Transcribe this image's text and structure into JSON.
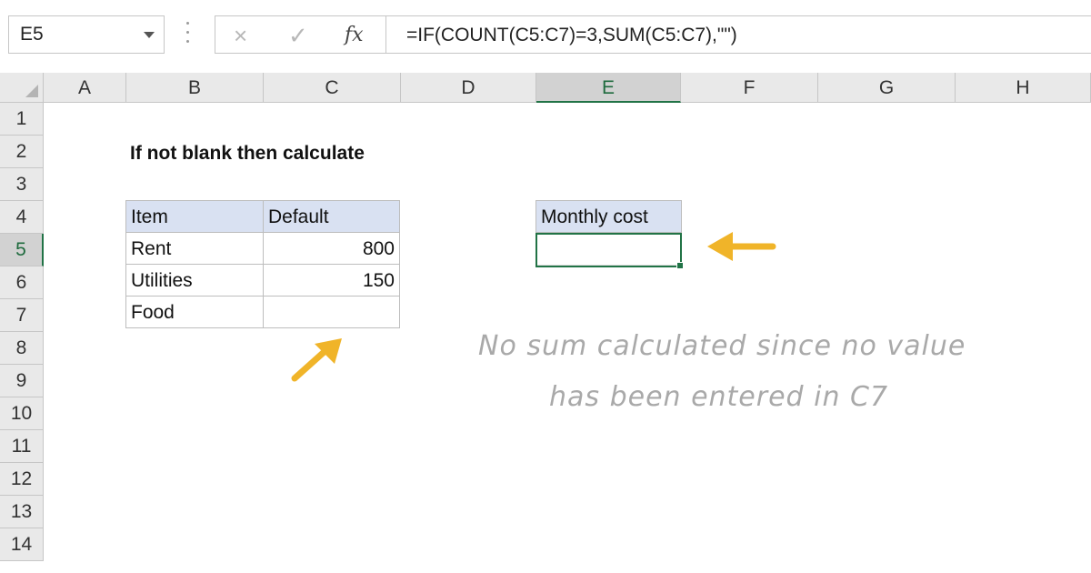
{
  "formula_bar": {
    "name_box": "E5",
    "cancel_icon": "×",
    "enter_icon": "✓",
    "function_icon": "fx",
    "formula": "=IF(COUNT(C5:C7)=3,SUM(C5:C7),\"\")"
  },
  "columns": [
    "A",
    "B",
    "C",
    "D",
    "E",
    "F",
    "G",
    "H"
  ],
  "rows": [
    "1",
    "2",
    "3",
    "4",
    "5",
    "6",
    "7",
    "8",
    "9",
    "10",
    "11",
    "12",
    "13",
    "14"
  ],
  "active_cell": "E5",
  "sheet": {
    "title": "If not blank then calculate",
    "table": {
      "headers": [
        "Item",
        "Default"
      ],
      "rows": [
        {
          "item": "Rent",
          "default": "800"
        },
        {
          "item": "Utilities",
          "default": "150"
        },
        {
          "item": "Food",
          "default": ""
        }
      ]
    },
    "result": {
      "header": "Monthly cost",
      "value": ""
    },
    "note_line1": "No sum calculated since no value",
    "note_line2": "has been entered in C7"
  },
  "colors": {
    "accent_green": "#217346",
    "table_header_fill": "#d9e1f2",
    "arrow": "#f0b429"
  }
}
